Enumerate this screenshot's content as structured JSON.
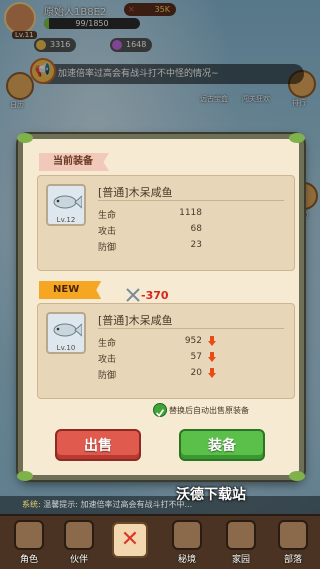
{
  "player": {
    "name": "原始人1B8E2",
    "level": "Lv.11",
    "hp": "99/1850",
    "hp_fraction": 0.05,
    "power": "35K"
  },
  "resources": [
    {
      "name": "gold",
      "value": "3316",
      "color": "#f2c14e"
    },
    {
      "name": "gem",
      "value": "1648",
      "color": "#c06ae0"
    }
  ],
  "notice": {
    "text": "加速倍率过高会有战斗打不中怪的情况~"
  },
  "side_labels": {
    "left_1": "日历",
    "right_1": "排行",
    "right_2": "活动",
    "mid_1": "远古宝盒",
    "mid_2": "闯关狂欢"
  },
  "modal": {
    "current_label": "当前装备",
    "new_label": "NEW",
    "current_item": {
      "name": "[普通]木呆咸鱼",
      "level": "Lv.12",
      "stats": [
        {
          "label": "生命",
          "value": "1118"
        },
        {
          "label": "攻击",
          "value": "68"
        },
        {
          "label": "防御",
          "value": "23"
        }
      ]
    },
    "new_item": {
      "name": "[普通]木呆咸鱼",
      "level": "Lv.10",
      "power_change": "-370",
      "stats": [
        {
          "label": "生命",
          "value": "952"
        },
        {
          "label": "攻击",
          "value": "57"
        },
        {
          "label": "防御",
          "value": "20"
        }
      ]
    },
    "auto_sell_label": "替换后自动出售原装备",
    "auto_sell_checked": true,
    "sell_button": "出售",
    "equip_button": "装备"
  },
  "chat": {
    "prefix": "系统:",
    "text": "温馨提示: 加速倍率过高会有战斗打不中..."
  },
  "watermark": "沃德下载站",
  "bottom_nav": [
    {
      "label": "角色"
    },
    {
      "label": "伙伴"
    },
    {
      "label": "秘境"
    },
    {
      "label": "家园"
    },
    {
      "label": "部落"
    }
  ]
}
